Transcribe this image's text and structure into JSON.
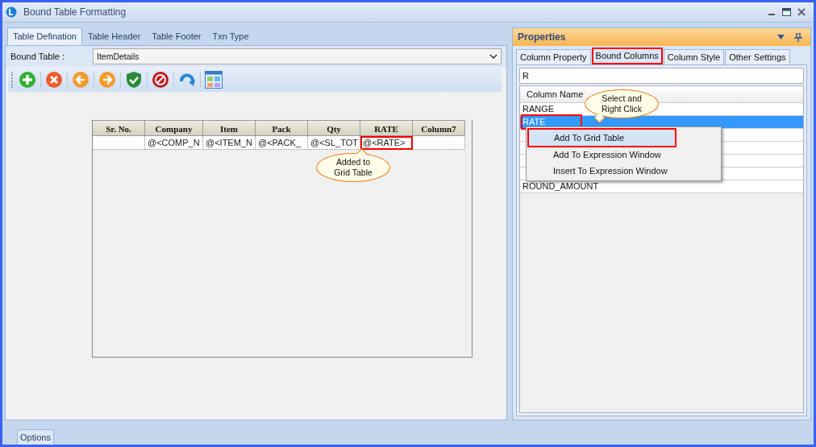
{
  "window": {
    "title": "Bound Table Formatting"
  },
  "tabs": [
    {
      "label": "Table Defination",
      "selected": true
    },
    {
      "label": "Table Header",
      "selected": false
    },
    {
      "label": "Table Footer",
      "selected": false
    },
    {
      "label": "Txn Type",
      "selected": false
    }
  ],
  "bound_table": {
    "label": "Bound Table :",
    "value": "ItemDetails"
  },
  "grid": {
    "columns": [
      "Sr. No.",
      "Company",
      "Item",
      "Pack",
      "Qty",
      "RATE",
      "Column7"
    ],
    "rows": [
      {
        "cells": [
          {
            "text": "",
            "highlighted": false
          },
          {
            "text": "@<COMP_N",
            "highlighted": false
          },
          {
            "text": "@<ITEM_N",
            "highlighted": false
          },
          {
            "text": "@<PACK_",
            "highlighted": false
          },
          {
            "text": "@<SL_TOT",
            "highlighted": false
          },
          {
            "text": "@<RATE>",
            "highlighted": true
          },
          {
            "text": "",
            "highlighted": false
          }
        ]
      }
    ]
  },
  "grid_callout": "Added to\nGrid Table",
  "properties": {
    "title": "Properties",
    "tabs": [
      {
        "label": "Column Property",
        "selected": false
      },
      {
        "label": "Bound Columns",
        "selected": true
      },
      {
        "label": "Column Style",
        "selected": false
      },
      {
        "label": "Other Settings",
        "selected": false
      }
    ],
    "search": {
      "value": "R"
    },
    "list_header": "Column Name",
    "rows": [
      {
        "kind": "item",
        "name": "RANGE",
        "selected": false
      },
      {
        "kind": "item",
        "name": "RATE",
        "selected": true
      },
      {
        "kind": "covered"
      },
      {
        "kind": "covered"
      },
      {
        "kind": "covered"
      },
      {
        "kind": "covered"
      },
      {
        "kind": "item",
        "name": "ROUND_AMOUNT",
        "selected": false
      }
    ],
    "callout": "Select and\nRight Click",
    "context_menu": [
      {
        "label": "Add To Grid Table",
        "selected": true
      },
      {
        "label": "Add To Expression Window",
        "selected": false
      },
      {
        "label": "Insert To Expression Window",
        "selected": false
      }
    ]
  },
  "footer_tab": "Options"
}
